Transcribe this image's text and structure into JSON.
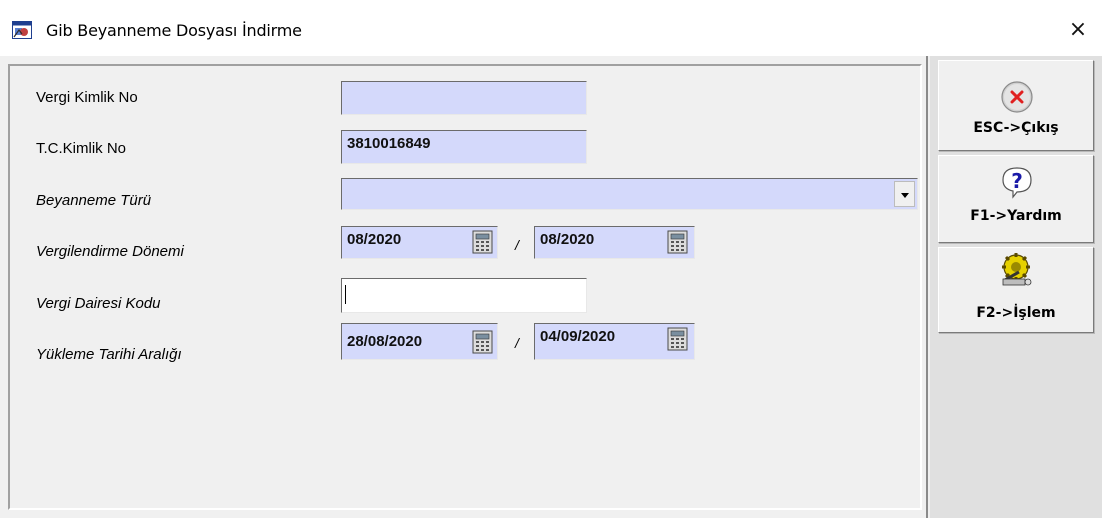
{
  "window": {
    "title": "Gib Beyanneme Dosyası İndirme",
    "close_glyph": "×",
    "title_icon": "app-window-icon"
  },
  "form": {
    "vkn_label": "Vergi Kimlik No",
    "vkn_value": "",
    "tckn_label": "T.C.Kimlik No",
    "tckn_value": "3810016849",
    "beyan_label": "Beyanneme Türü",
    "beyan_value": "",
    "donem_label": "Vergilendirme Dönemi",
    "donem_start": "08/2020",
    "donem_end": "08/2020",
    "vd_label": "Vergi Dairesi Kodu",
    "vd_value": "",
    "yukleme_label": "Yükleme Tarihi Aralığı",
    "yukleme_start": "28/08/2020",
    "yukleme_end": "04/09/2020",
    "range_separator": "/"
  },
  "side_buttons": {
    "exit_label": "ESC->Çıkış",
    "help_label": "F1->Yardım",
    "process_label": "F2->İşlem"
  },
  "colors": {
    "field_bg": "#d4d9fb",
    "panel_bg": "#f0f0f0",
    "exit_icon": "#e02020",
    "help_icon": "#1a1aa8",
    "process_icon": "#e6d100"
  }
}
